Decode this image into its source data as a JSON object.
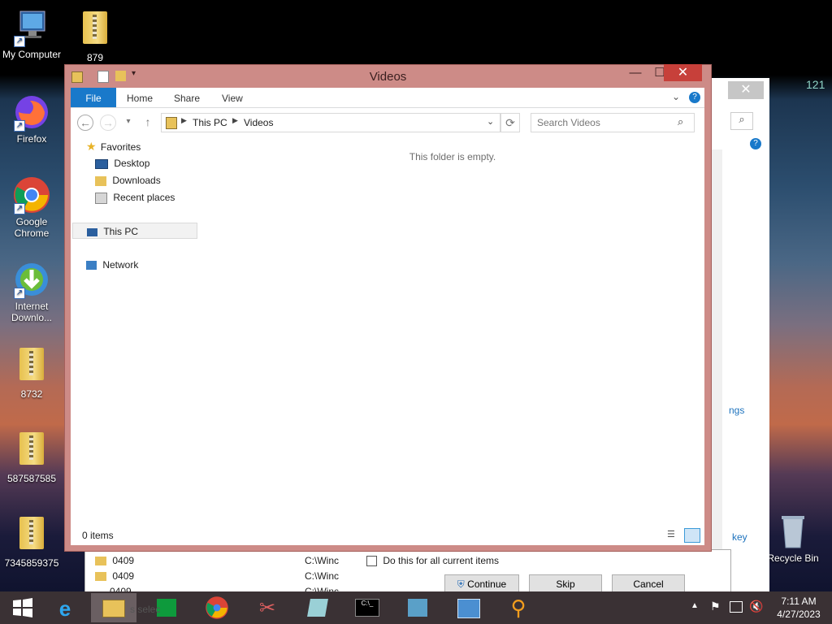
{
  "desktop": {
    "icons": [
      {
        "label": "My Computer"
      },
      {
        "label": "879"
      },
      {
        "label": "Firefox"
      },
      {
        "label": "Google Chrome"
      },
      {
        "label": "Internet Downlo..."
      },
      {
        "label": "8732"
      },
      {
        "label": "587587585"
      },
      {
        "label": "7345859375"
      },
      {
        "label": "Recycle Bin"
      }
    ],
    "corner_text": "121"
  },
  "background_window": {
    "link_text": "ngs",
    "key_text": "key"
  },
  "copy_dialog": {
    "rows": [
      {
        "name": "0409",
        "path": "C:\\Winc"
      },
      {
        "name": "0409",
        "path": "C:\\Winc"
      },
      {
        "name": "0409",
        "path": "C:\\Winc"
      }
    ],
    "checkbox_label": "Do this for all current items",
    "continue_label": "Continue",
    "skip_label": "Skip",
    "cancel_label": "Cancel",
    "select_text": "s selec"
  },
  "explorer": {
    "title": "Videos",
    "ribbon_tabs": [
      "File",
      "Home",
      "Share",
      "View"
    ],
    "breadcrumb": [
      "This PC",
      "Videos"
    ],
    "search_placeholder": "Search Videos",
    "nav": {
      "favorites": "Favorites",
      "desktop": "Desktop",
      "downloads": "Downloads",
      "recent": "Recent places",
      "this_pc": "This PC",
      "network": "Network"
    },
    "empty_message": "This folder is empty.",
    "status": "0 items"
  },
  "taskbar": {
    "time": "7:11 AM",
    "date": "4/27/2023"
  },
  "colors": {
    "accent": "#1979ca",
    "title_bar": "#cd8b87",
    "close": "#c7403a"
  }
}
